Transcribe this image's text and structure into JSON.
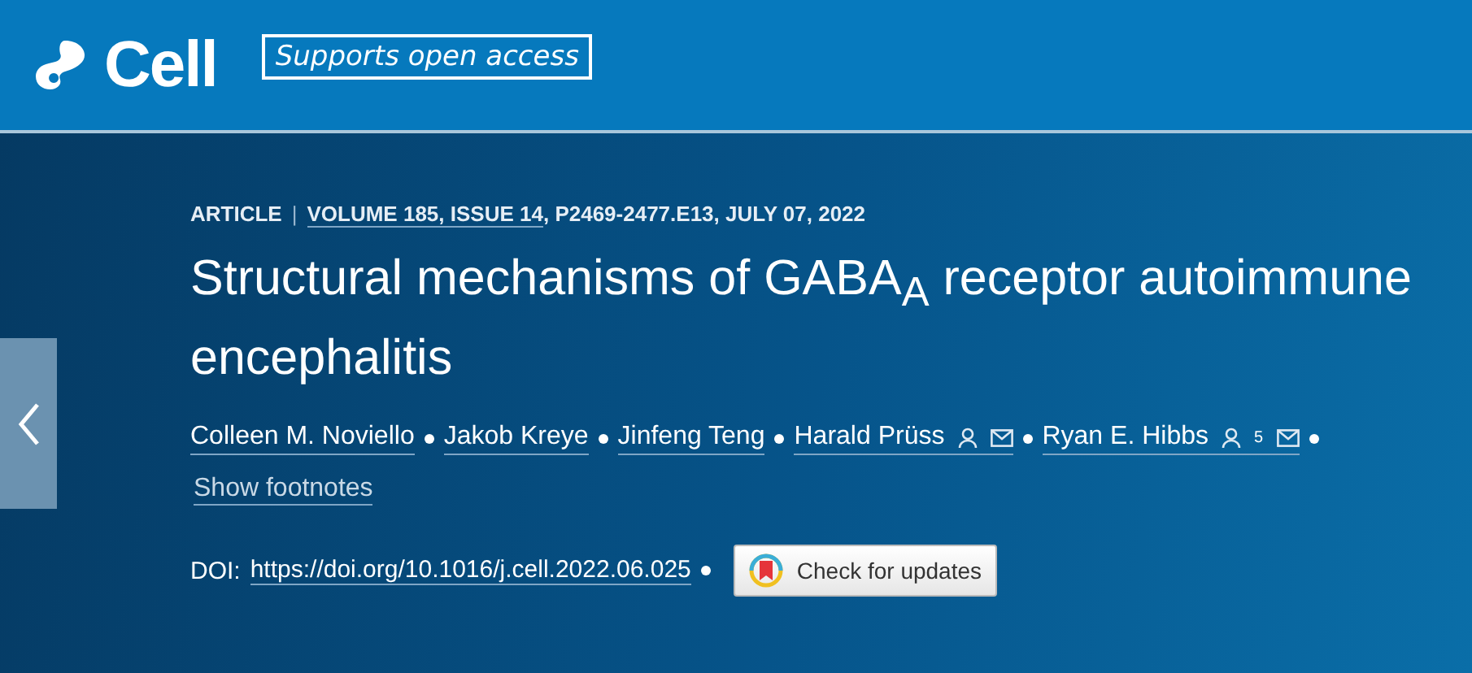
{
  "header": {
    "logo_text": "Cell",
    "badge": "Supports open access"
  },
  "article": {
    "type_label": "ARTICLE",
    "separator": "|",
    "volume_issue": "VOLUME 185, ISSUE 14",
    "pages_date": ", P2469-2477.E13, JULY 07, 2022",
    "title": "Structural mechanisms of GABA$_{A}$ receptor autoimmune encephalitis",
    "authors": [
      {
        "name": "Colleen M. Noviello",
        "has_profile": false,
        "has_email": false
      },
      {
        "name": "Jakob Kreye",
        "has_profile": false,
        "has_email": false
      },
      {
        "name": "Jinfeng Teng",
        "has_profile": false,
        "has_email": false
      },
      {
        "name": "Harald Prüss",
        "has_profile": true,
        "has_email": true
      },
      {
        "name": "Ryan E. Hibbs",
        "has_profile": true,
        "footnote": "5",
        "has_email": true
      }
    ],
    "footnotes_link": "Show footnotes",
    "doi_label": "DOI:",
    "doi": "https://doi.org/10.1016/j.cell.2022.06.025",
    "updates_button": "Check for updates"
  }
}
